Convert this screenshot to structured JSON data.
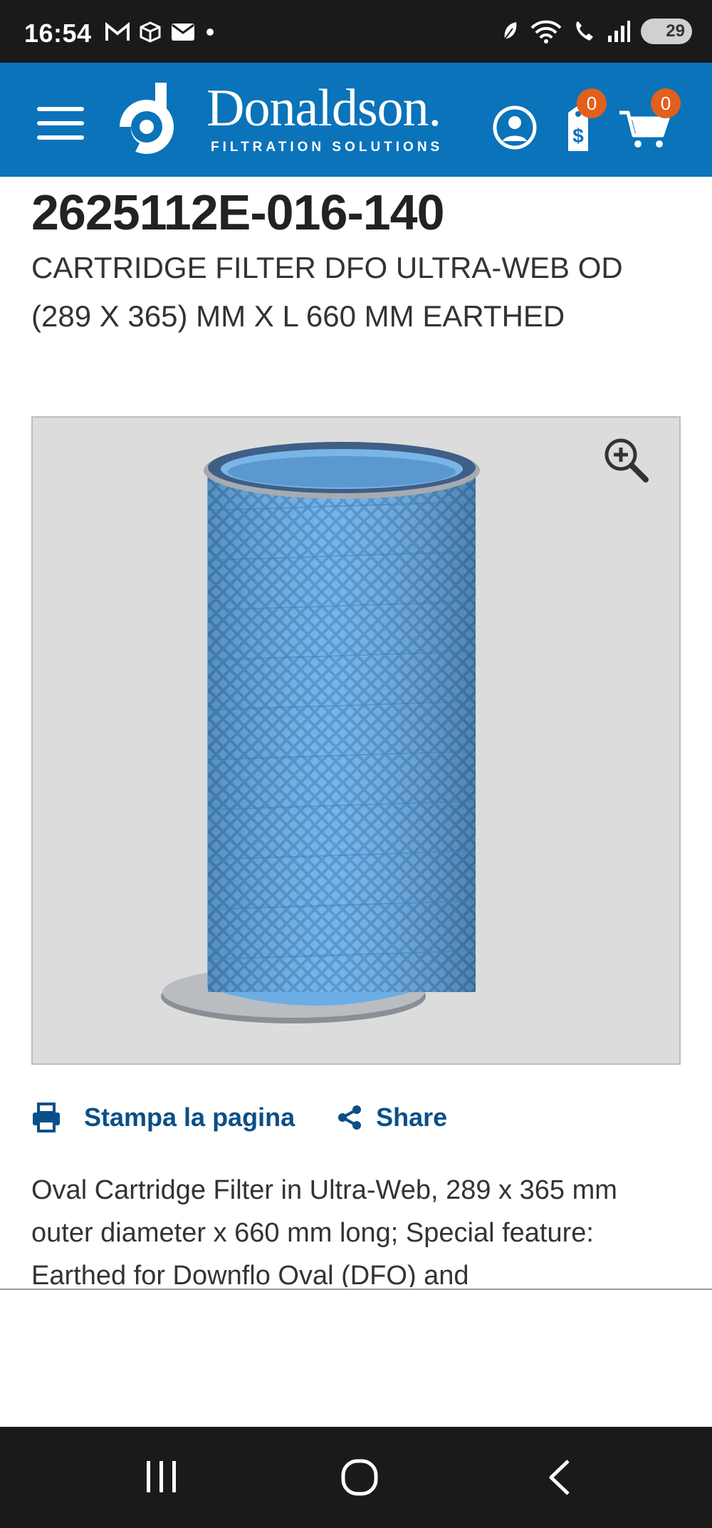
{
  "status_bar": {
    "time": "16:54",
    "battery": "29",
    "left_icons": [
      "gmail-icon",
      "package-icon",
      "mail-icon",
      "dot-icon"
    ],
    "right_icons": [
      "leaf-icon",
      "wifi-icon",
      "wifi-call-icon",
      "signal-icon"
    ]
  },
  "header": {
    "brand_name": "Donaldson.",
    "brand_tagline": "FILTRATION SOLUTIONS",
    "quote_count": "0",
    "cart_count": "0",
    "colors": {
      "header_bg": "#0a73ba",
      "badge": "#e35f1c"
    }
  },
  "product": {
    "number": "2625112E-016-140",
    "description": "CARTRIDGE FILTER DFO ULTRA-WEB OD (289 X 365) MM X L 660 MM EARTHED"
  },
  "actions": {
    "print_label": "Stampa la pagina",
    "share_label": "Share"
  },
  "details": {
    "text": "Oval Cartridge Filter in Ultra-Web, 289 x 365 mm outer diameter x 660 mm long; Special feature: Earthed for Downflo Oval (DFO) and"
  }
}
